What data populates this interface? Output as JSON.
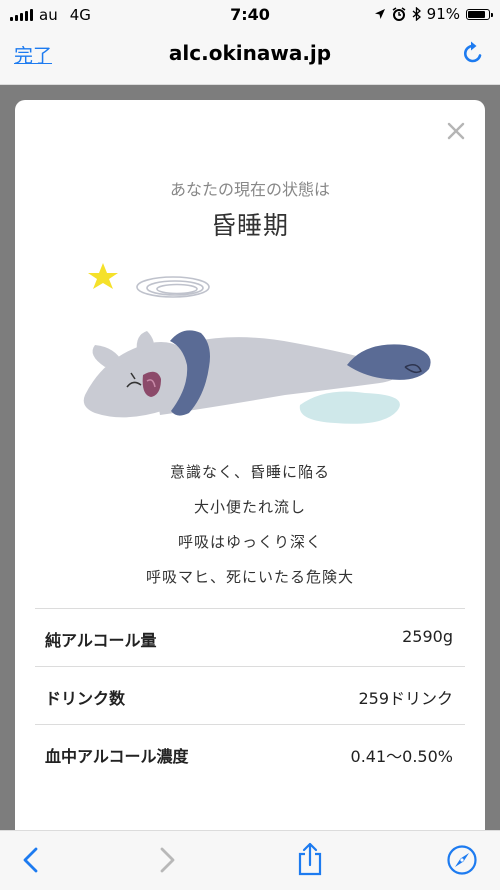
{
  "status_bar": {
    "carrier": "au",
    "network": "4G",
    "time": "7:40",
    "battery_text": "91%",
    "battery_level": 0.91
  },
  "nav": {
    "done_label": "完了",
    "url": "alc.okinawa.jp"
  },
  "modal": {
    "subtitle": "あなたの現在の状態は",
    "title": "昏睡期",
    "symptoms": [
      "意識なく、昏睡に陥る",
      "大小便たれ流し",
      "呼吸はゆっくり深く",
      "呼吸マヒ、死にいたる危険大"
    ],
    "stats": [
      {
        "label": "純アルコール量",
        "value": "2590g"
      },
      {
        "label": "ドリンク数",
        "value": "259ドリンク"
      },
      {
        "label": "血中アルコール濃度",
        "value": "0.41〜0.50%"
      }
    ]
  },
  "colors": {
    "accent": "#1d7bf0",
    "creature_body": "#c9cbd3",
    "creature_hair": "#5a6b95",
    "puddle": "#cfe8ea",
    "star": "#f5e12a"
  },
  "icons": {
    "reload": "reload-icon",
    "close": "close-icon",
    "back": "chevron-left-icon",
    "forward": "chevron-right-icon",
    "share": "share-icon",
    "safari": "compass-icon"
  }
}
